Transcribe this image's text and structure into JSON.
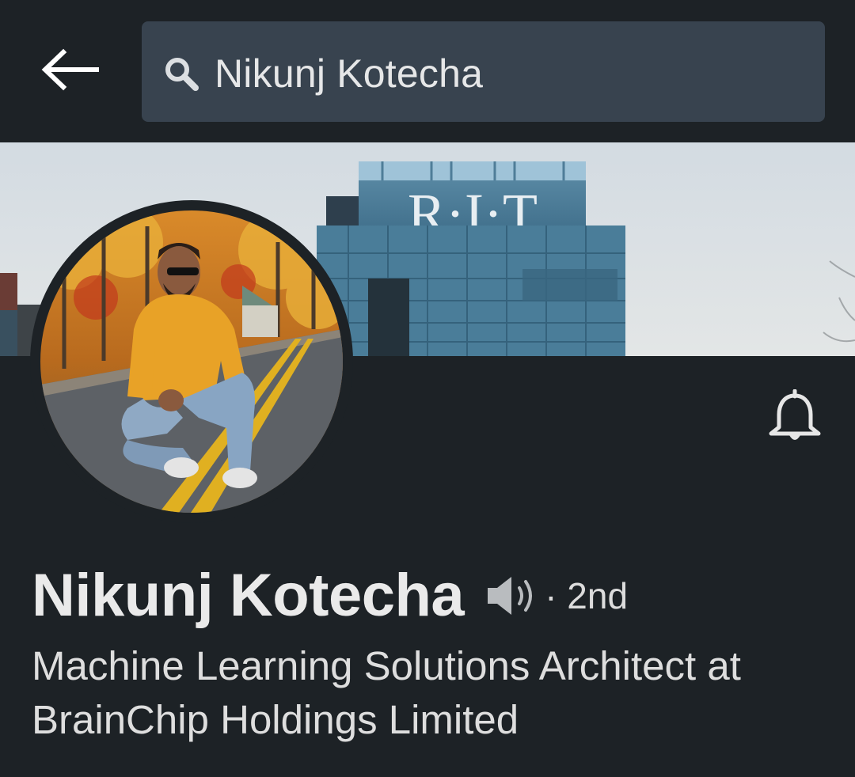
{
  "search": {
    "query": "Nikunj Kotecha"
  },
  "cover": {
    "building_sign": "R·I·T"
  },
  "profile": {
    "name": "Nikunj Kotecha",
    "degree": "· 2nd",
    "headline": "Machine Learning Solutions Architect at BrainChip Holdings Limited"
  },
  "icons": {
    "back": "arrow-left-icon",
    "search": "search-icon",
    "bell": "bell-icon",
    "pronunciation": "speaker-icon"
  },
  "colors": {
    "background": "#1d2226",
    "search_field": "#38434f",
    "text_primary": "#eaeaea"
  }
}
